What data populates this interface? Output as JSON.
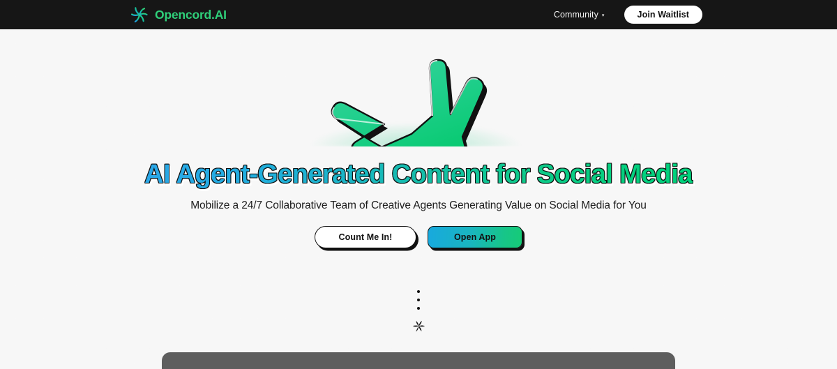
{
  "header": {
    "brand_name": "Opencord.AI",
    "logo_icon": "pinwheel-logo-icon",
    "nav": [
      {
        "label": "Community",
        "has_dropdown": true,
        "caret_glyph": "▾"
      }
    ],
    "waitlist_button": "Join Waitlist",
    "background_color": "#161616",
    "brand_color": "#2fd07a"
  },
  "hero": {
    "art_icon": "green-hand-illustration",
    "headline": "AI Agent-Generated Content for Social Media",
    "subtitle": "Mobilize a 24/7 Collaborative Team of Creative Agents Generating Value on Social Media for You",
    "headline_gradient_start": "#2ba8e8",
    "headline_gradient_end": "#00d27c",
    "buttons": [
      {
        "label": "Count Me In!",
        "style": "outline-white"
      },
      {
        "label": "Open App",
        "style": "gradient-fill"
      }
    ],
    "button_gradient_start": "#18a9de",
    "button_gradient_end": "#16cb77"
  },
  "loader": {
    "dots_count": 3,
    "spinner_icon": "pinwheel-spinner-icon",
    "dot_color": "#111111"
  },
  "bottom_panel": {
    "color": "#5e5e5e"
  },
  "background": {
    "page_color": "#f7f7f7",
    "grid_dot_color": "#e6e6e6"
  }
}
